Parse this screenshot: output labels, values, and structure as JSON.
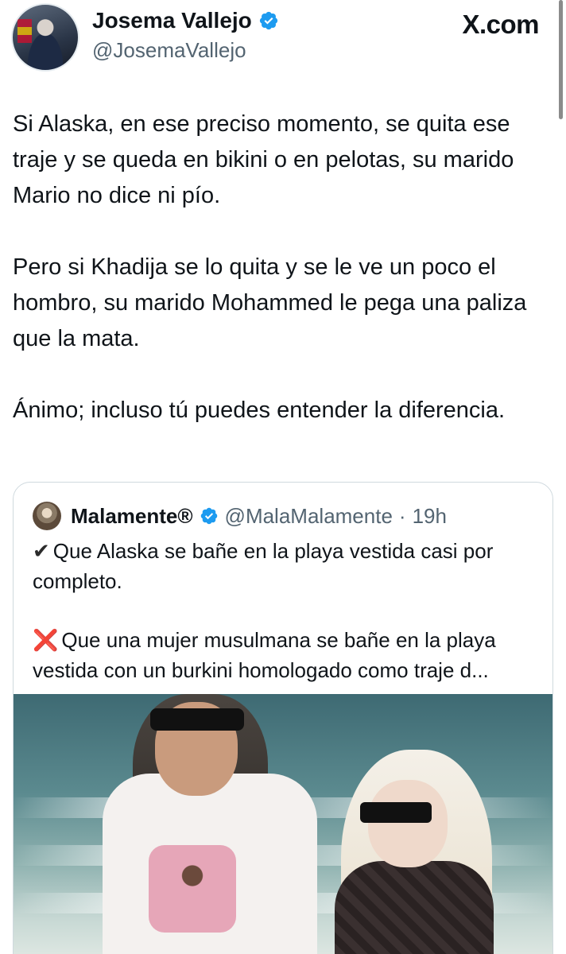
{
  "author": {
    "name": "Josema Vallejo",
    "handle": "@JosemaVallejo",
    "verified": true,
    "avatar_icon": "profile-photo"
  },
  "site_label": "X.com",
  "tweet": {
    "paragraphs": [
      "Si Alaska, en ese preciso momento, se quita ese traje y se queda en bikini o en pelotas, su marido Mario no dice ni pío.",
      "Pero si Khadija se lo quita y se le ve un poco el hombro, su marido Mohammed le pega una paliza que la mata.",
      "Ánimo; incluso tú puedes entender la diferencia."
    ]
  },
  "quoted_tweet": {
    "name": "Malamente®",
    "handle": "@MalaMalamente",
    "separator": "·",
    "time": "19h",
    "verified": true,
    "lines": [
      {
        "mark": "✔",
        "text": "Que Alaska se bañe en la playa vestida casi por completo."
      },
      {
        "mark": "❌",
        "text": "Que una mujer musulmana se bañe en la playa vestida con un burkini homologado como traje d..."
      }
    ],
    "media_icon": "beach-photo"
  },
  "colors": {
    "verified_blue": "#1d9bf0",
    "text": "#0f1419",
    "secondary_text": "#536471",
    "border": "#cfd9de",
    "cross_red": "#dd2e44"
  }
}
